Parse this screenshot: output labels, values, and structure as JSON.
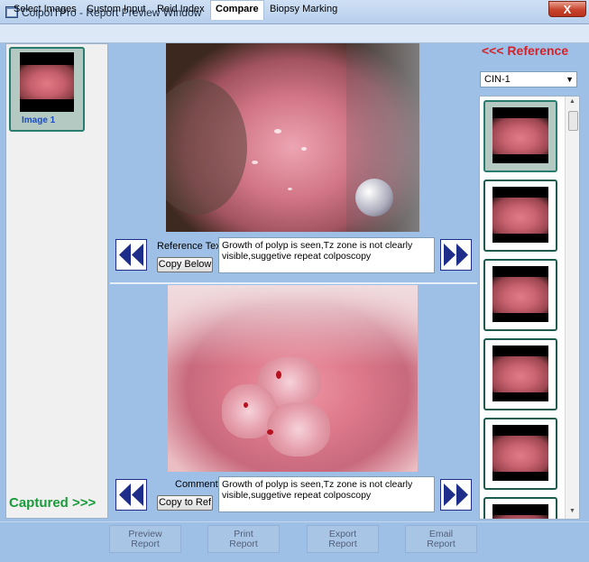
{
  "window": {
    "app": "ColpoITPro",
    "separator": " - ",
    "title": "Report Preview Window",
    "close": "X"
  },
  "tabs": [
    "Select Images",
    "Custom Input",
    "Reid Index",
    "Compare",
    "Biopsy Marking"
  ],
  "active_tab": "Compare",
  "captured": {
    "images": [
      {
        "label": "Image 1"
      }
    ],
    "label": "Captured >>>"
  },
  "reference": {
    "label": "<<< Reference",
    "selected_category": "CIN-1",
    "text_label": "Reference Text:",
    "copy_button": "Copy Below",
    "text": "Growth of polyp is seen,Tz zone is not clearly visible,suggetive repeat colposcopy"
  },
  "comments": {
    "label": "Comments:",
    "copy_button": "Copy to Ref",
    "text": "Growth of polyp is seen,Tz zone is not clearly visible,suggetive repeat colposcopy"
  },
  "bottom_buttons": [
    {
      "line1": "Preview",
      "line2": "Report"
    },
    {
      "line1": "Print",
      "line2": "Report"
    },
    {
      "line1": "Export",
      "line2": "Report"
    },
    {
      "line1": "Email",
      "line2": "Report"
    }
  ],
  "colors": {
    "reference_red": "#d3232a",
    "captured_green": "#1a9a3a",
    "nav_blue": "#1f2d8a",
    "panel_blue": "#9fc0e6"
  }
}
